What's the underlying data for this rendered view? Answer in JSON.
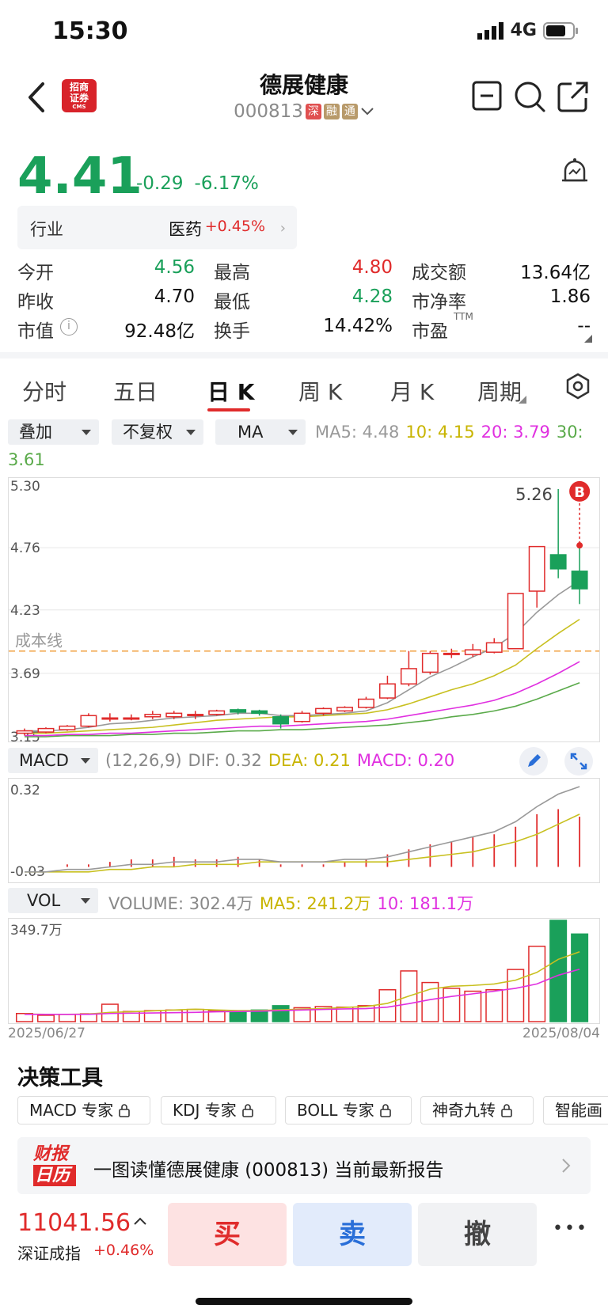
{
  "status": {
    "time": "15:30",
    "network": "4G"
  },
  "header": {
    "logo_line1": "招商",
    "logo_line2": "证券",
    "logo_sub": "CMS",
    "stock_name": "德展健康",
    "stock_code": "000813",
    "tags": [
      "深",
      "融",
      "通"
    ]
  },
  "quote": {
    "price": "4.41",
    "change": "-0.29",
    "change_pct": "-6.17%",
    "industry_label": "行业",
    "industry_name": "医药",
    "industry_pct": "+0.45%"
  },
  "stats": [
    [
      {
        "label": "今开",
        "value": "4.56",
        "color": "#1aa05a"
      },
      {
        "label": "最高",
        "value": "4.80",
        "color": "#e02b2b"
      },
      {
        "label": "成交额",
        "value": "13.64亿",
        "color": "#111111"
      }
    ],
    [
      {
        "label": "昨收",
        "value": "4.70",
        "color": "#111111"
      },
      {
        "label": "最低",
        "value": "4.28",
        "color": "#1aa05a"
      },
      {
        "label": "市净率",
        "value": "1.86",
        "color": "#111111"
      }
    ],
    [
      {
        "label": "市值",
        "value": "92.48亿",
        "color": "#111111"
      },
      {
        "label": "换手",
        "value": "14.42%",
        "color": "#111111"
      },
      {
        "label": "市盈",
        "value": "--",
        "color": "#111111"
      }
    ]
  ],
  "ttm_sup": "TTM",
  "tabs": [
    "分时",
    "五日",
    "日 K",
    "周 K",
    "月 K",
    "周期"
  ],
  "active_tab": 2,
  "controls": {
    "overlay": "叠加",
    "adjust": "不复权",
    "indicator": "MA",
    "ma5": "MA5: 4.48",
    "ma10": "10: 4.15",
    "ma20": "20: 3.79",
    "ma30": "30:",
    "ma30_val": "3.61"
  },
  "colors": {
    "up": "#e02b2b",
    "down": "#1aa05a",
    "ma5": "#999999",
    "ma10": "#c8c020",
    "ma20": "#e030e0",
    "ma30": "#5aaa4a"
  },
  "kline": {
    "axis_labels": [
      "5.30",
      "4.76",
      "4.23",
      "3.69",
      "3.15"
    ],
    "cost_line_label": "成本线",
    "high_label": "5.26",
    "buy_marker": "B"
  },
  "macd": {
    "selector": "MACD",
    "params": "(12,26,9)",
    "dif": "DIF: 0.32",
    "dea": "DEA: 0.21",
    "macd": "MACD: 0.20",
    "axis_top": "0.32",
    "axis_bottom": "-0.03"
  },
  "vol": {
    "selector": "VOL",
    "volume": "VOLUME: 302.4万",
    "ma5": "MA5: 241.2万",
    "ma10": "10: 181.1万",
    "axis_top": "349.7万",
    "date_start": "2025/06/27",
    "date_end": "2025/08/04"
  },
  "chart_data": {
    "type": "candlestick",
    "title": "",
    "ylim": [
      3.15,
      5.3
    ],
    "candles": [
      {
        "o": 3.18,
        "c": 3.2,
        "h": 3.22,
        "l": 3.16
      },
      {
        "o": 3.19,
        "c": 3.22,
        "h": 3.23,
        "l": 3.18
      },
      {
        "o": 3.21,
        "c": 3.24,
        "h": 3.25,
        "l": 3.2
      },
      {
        "o": 3.24,
        "c": 3.33,
        "h": 3.35,
        "l": 3.23
      },
      {
        "o": 3.31,
        "c": 3.31,
        "h": 3.35,
        "l": 3.28
      },
      {
        "o": 3.31,
        "c": 3.31,
        "h": 3.34,
        "l": 3.29
      },
      {
        "o": 3.32,
        "c": 3.34,
        "h": 3.37,
        "l": 3.3
      },
      {
        "o": 3.32,
        "c": 3.35,
        "h": 3.37,
        "l": 3.3
      },
      {
        "o": 3.34,
        "c": 3.34,
        "h": 3.37,
        "l": 3.3
      },
      {
        "o": 3.34,
        "c": 3.37,
        "h": 3.38,
        "l": 3.33
      },
      {
        "o": 3.38,
        "c": 3.36,
        "h": 3.39,
        "l": 3.34
      },
      {
        "o": 3.37,
        "c": 3.35,
        "h": 3.38,
        "l": 3.33
      },
      {
        "o": 3.32,
        "c": 3.26,
        "h": 3.34,
        "l": 3.22
      },
      {
        "o": 3.28,
        "c": 3.35,
        "h": 3.37,
        "l": 3.27
      },
      {
        "o": 3.35,
        "c": 3.39,
        "h": 3.4,
        "l": 3.33
      },
      {
        "o": 3.37,
        "c": 3.4,
        "h": 3.41,
        "l": 3.36
      },
      {
        "o": 3.4,
        "c": 3.47,
        "h": 3.49,
        "l": 3.39
      },
      {
        "o": 3.48,
        "c": 3.6,
        "h": 3.67,
        "l": 3.47
      },
      {
        "o": 3.6,
        "c": 3.73,
        "h": 3.88,
        "l": 3.58
      },
      {
        "o": 3.7,
        "c": 3.86,
        "h": 3.88,
        "l": 3.68
      },
      {
        "o": 3.86,
        "c": 3.86,
        "h": 3.9,
        "l": 3.82
      },
      {
        "o": 3.85,
        "c": 3.89,
        "h": 3.94,
        "l": 3.83
      },
      {
        "o": 3.87,
        "c": 3.95,
        "h": 3.99,
        "l": 3.86
      },
      {
        "o": 3.9,
        "c": 4.37,
        "h": 4.37,
        "l": 3.9
      },
      {
        "o": 4.39,
        "c": 4.77,
        "h": 4.77,
        "l": 4.25
      },
      {
        "o": 4.7,
        "c": 4.58,
        "h": 5.26,
        "l": 4.5
      },
      {
        "o": 4.56,
        "c": 4.41,
        "h": 4.8,
        "l": 4.28
      }
    ],
    "ma5": [
      3.2,
      3.2,
      3.21,
      3.23,
      3.26,
      3.27,
      3.29,
      3.31,
      3.32,
      3.33,
      3.35,
      3.35,
      3.33,
      3.33,
      3.34,
      3.35,
      3.37,
      3.44,
      3.55,
      3.66,
      3.74,
      3.83,
      3.91,
      4.03,
      4.21,
      4.36,
      4.48
    ],
    "ma10": [
      3.18,
      3.18,
      3.19,
      3.2,
      3.21,
      3.22,
      3.23,
      3.25,
      3.27,
      3.29,
      3.3,
      3.31,
      3.32,
      3.32,
      3.33,
      3.34,
      3.35,
      3.38,
      3.43,
      3.49,
      3.55,
      3.6,
      3.67,
      3.76,
      3.9,
      4.03,
      4.15
    ],
    "ma20": [
      3.16,
      3.16,
      3.17,
      3.17,
      3.18,
      3.18,
      3.19,
      3.2,
      3.21,
      3.22,
      3.23,
      3.24,
      3.24,
      3.25,
      3.26,
      3.27,
      3.28,
      3.3,
      3.33,
      3.36,
      3.39,
      3.42,
      3.46,
      3.52,
      3.6,
      3.69,
      3.79
    ],
    "ma30": [
      3.15,
      3.15,
      3.16,
      3.16,
      3.16,
      3.17,
      3.17,
      3.18,
      3.18,
      3.19,
      3.2,
      3.2,
      3.21,
      3.21,
      3.22,
      3.23,
      3.24,
      3.25,
      3.27,
      3.29,
      3.32,
      3.34,
      3.37,
      3.41,
      3.47,
      3.54,
      3.61
    ],
    "macd_ylim": [
      -0.03,
      0.32
    ],
    "dif": [
      -0.02,
      -0.02,
      -0.01,
      -0.01,
      0.0,
      0.01,
      0.01,
      0.02,
      0.02,
      0.02,
      0.03,
      0.03,
      0.02,
      0.02,
      0.02,
      0.03,
      0.03,
      0.04,
      0.06,
      0.08,
      0.1,
      0.12,
      0.14,
      0.18,
      0.24,
      0.29,
      0.32
    ],
    "dea": [
      -0.02,
      -0.02,
      -0.02,
      -0.02,
      -0.01,
      -0.01,
      0.0,
      0.0,
      0.01,
      0.01,
      0.01,
      0.02,
      0.02,
      0.02,
      0.02,
      0.02,
      0.02,
      0.02,
      0.03,
      0.04,
      0.05,
      0.06,
      0.08,
      0.1,
      0.13,
      0.17,
      0.21
    ],
    "macd": [
      0.0,
      0.0,
      0.01,
      0.01,
      0.02,
      0.03,
      0.03,
      0.04,
      0.03,
      0.03,
      0.04,
      0.03,
      0.01,
      0.01,
      0.01,
      0.02,
      0.03,
      0.05,
      0.07,
      0.09,
      0.1,
      0.12,
      0.13,
      0.16,
      0.21,
      0.23,
      0.2
    ],
    "vol_max": 349.7,
    "volume": [
      28,
      22,
      25,
      27,
      60,
      35,
      38,
      40,
      42,
      38,
      32,
      40,
      55,
      48,
      52,
      50,
      55,
      110,
      175,
      135,
      115,
      105,
      110,
      180,
      260,
      349.7,
      302.4
    ],
    "vol_ma5": [
      26,
      25,
      25,
      26,
      32,
      34,
      37,
      40,
      43,
      40,
      38,
      38,
      41,
      43,
      45,
      49,
      52,
      63,
      88,
      112,
      122,
      125,
      130,
      143,
      170,
      215,
      241.2
    ],
    "vol_ma10": [
      25,
      25,
      25,
      25,
      28,
      29,
      30,
      31,
      32,
      34,
      35,
      36,
      38,
      40,
      42,
      44,
      45,
      50,
      62,
      76,
      87,
      96,
      105,
      115,
      130,
      160,
      181.1
    ]
  },
  "tools": {
    "title": "决策工具",
    "items": [
      "MACD 专家",
      "KDJ 专家",
      "BOLL 专家",
      "神奇九转",
      "智能画"
    ]
  },
  "report": {
    "badge_line1": "财报",
    "badge_line2": "日历",
    "text": "一图读懂德展健康 (000813) 当前最新报告"
  },
  "bottom": {
    "index_value": "11041.56",
    "index_name": "深证成指",
    "index_pct": "+0.46%",
    "buy": "买",
    "sell": "卖",
    "cancel": "撤",
    "more": "•••"
  }
}
